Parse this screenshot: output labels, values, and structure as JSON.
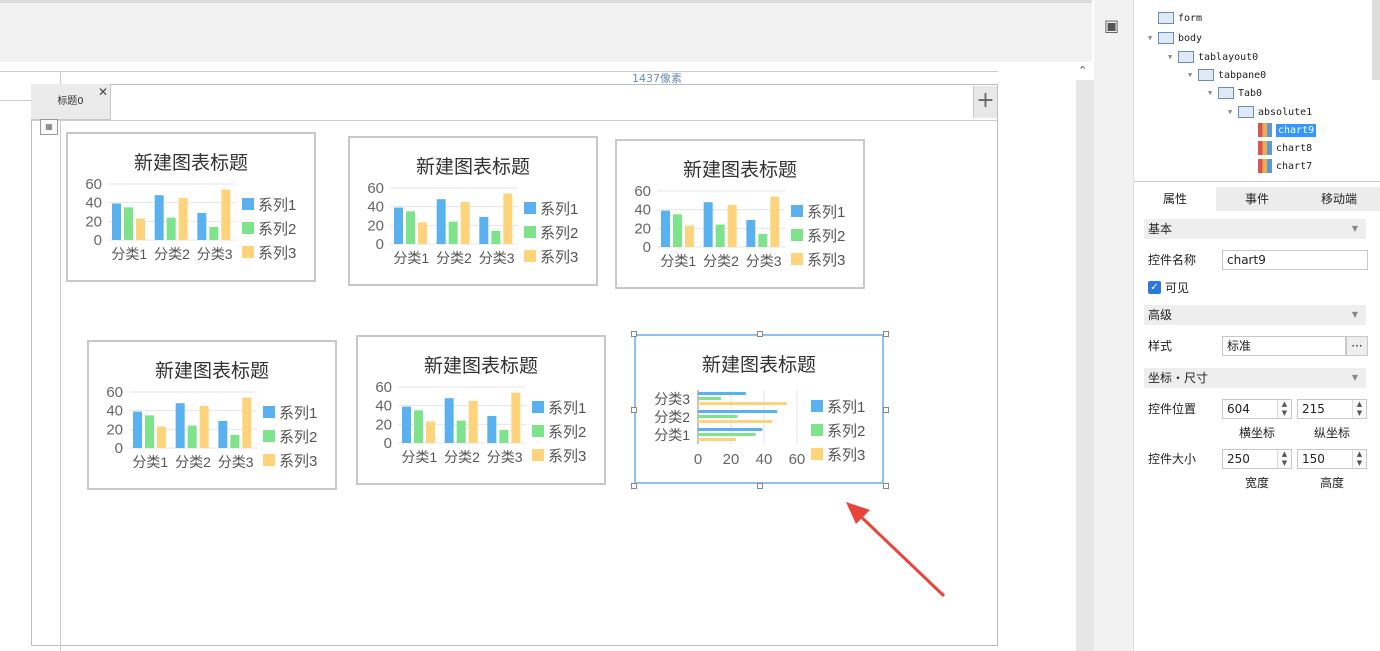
{
  "ruler": {
    "label": "1437像素"
  },
  "tab": {
    "label": "标题0",
    "close": "✕"
  },
  "tree": {
    "nodes": [
      {
        "label": "form",
        "level": 0,
        "expanded": false,
        "icon": "form-icon"
      },
      {
        "label": "body",
        "level": 0,
        "expanded": true,
        "icon": "body-icon"
      },
      {
        "label": "tablayout0",
        "level": 1,
        "expanded": true,
        "icon": "tablayout-icon"
      },
      {
        "label": "tabpane0",
        "level": 2,
        "expanded": true,
        "icon": "tabpane-icon"
      },
      {
        "label": "Tab0",
        "level": 3,
        "expanded": true,
        "icon": "tab-icon"
      },
      {
        "label": "absolute1",
        "level": 4,
        "expanded": true,
        "icon": "absolute-icon"
      },
      {
        "label": "chart9",
        "level": 5,
        "selected": true,
        "icon": "chart-icon"
      },
      {
        "label": "chart8",
        "level": 5,
        "icon": "chart-icon"
      },
      {
        "label": "chart7",
        "level": 5,
        "icon": "chart-icon"
      }
    ]
  },
  "panel_tabs": [
    {
      "label": "属性",
      "active": true
    },
    {
      "label": "事件"
    },
    {
      "label": "移动端"
    }
  ],
  "props": {
    "basic": "基本",
    "name_label": "控件名称",
    "name_value": "chart9",
    "visible_label": "可见",
    "advanced": "高级",
    "style_label": "样式",
    "style_value": "标准",
    "style_more": "···",
    "coord": "坐标・尺寸",
    "pos_label": "控件位置",
    "pos_x": "604",
    "pos_y": "215",
    "x_caption": "横坐标",
    "y_caption": "纵坐标",
    "size_label": "控件大小",
    "width": "250",
    "height": "150",
    "w_caption": "宽度",
    "h_caption": "高度"
  },
  "chart_data": [
    {
      "type": "bar",
      "title": "新建图表标题",
      "categories": [
        "分类1",
        "分类2",
        "分类3"
      ],
      "yticks": [
        "0",
        "20",
        "40",
        "60"
      ],
      "ylim": [
        0,
        60
      ],
      "legend": "right",
      "series": [
        {
          "name": "系列1",
          "values": [
            39,
            48,
            29
          ],
          "color": "#5ab1ef"
        },
        {
          "name": "系列2",
          "values": [
            35,
            24,
            14
          ],
          "color": "#7ee38b"
        },
        {
          "name": "系列3",
          "values": [
            23,
            45,
            54
          ],
          "color": "#fdd47c"
        }
      ]
    },
    {
      "type": "bar",
      "title": "新建图表标题",
      "categories": [
        "分类1",
        "分类2",
        "分类3"
      ],
      "yticks": [
        "0",
        "20",
        "40",
        "60"
      ],
      "ylim": [
        0,
        60
      ],
      "legend": "right",
      "series": [
        {
          "name": "系列1",
          "values": [
            39,
            48,
            29
          ],
          "color": "#5ab1ef"
        },
        {
          "name": "系列2",
          "values": [
            35,
            24,
            14
          ],
          "color": "#7ee38b"
        },
        {
          "name": "系列3",
          "values": [
            23,
            45,
            54
          ],
          "color": "#fdd47c"
        }
      ]
    },
    {
      "type": "bar",
      "title": "新建图表标题",
      "categories": [
        "分类1",
        "分类2",
        "分类3"
      ],
      "yticks": [
        "0",
        "20",
        "40",
        "60"
      ],
      "ylim": [
        0,
        60
      ],
      "legend": "right",
      "series": [
        {
          "name": "系列1",
          "values": [
            39,
            48,
            29
          ],
          "color": "#5ab1ef"
        },
        {
          "name": "系列2",
          "values": [
            35,
            24,
            14
          ],
          "color": "#7ee38b"
        },
        {
          "name": "系列3",
          "values": [
            23,
            45,
            54
          ],
          "color": "#fdd47c"
        }
      ]
    },
    {
      "type": "bar",
      "title": "新建图表标题",
      "categories": [
        "分类1",
        "分类2",
        "分类3"
      ],
      "yticks": [
        "0",
        "20",
        "40",
        "60"
      ],
      "ylim": [
        0,
        60
      ],
      "legend": "right",
      "series": [
        {
          "name": "系列1",
          "values": [
            39,
            48,
            29
          ],
          "color": "#5ab1ef"
        },
        {
          "name": "系列2",
          "values": [
            35,
            24,
            14
          ],
          "color": "#7ee38b"
        },
        {
          "name": "系列3",
          "values": [
            23,
            45,
            54
          ],
          "color": "#fdd47c"
        }
      ]
    },
    {
      "type": "bar",
      "title": "新建图表标题",
      "categories": [
        "分类1",
        "分类2",
        "分类3"
      ],
      "yticks": [
        "0",
        "20",
        "40",
        "60"
      ],
      "ylim": [
        0,
        60
      ],
      "legend": "right",
      "series": [
        {
          "name": "系列1",
          "values": [
            39,
            48,
            29
          ],
          "color": "#5ab1ef"
        },
        {
          "name": "系列2",
          "values": [
            35,
            24,
            14
          ],
          "color": "#7ee38b"
        },
        {
          "name": "系列3",
          "values": [
            23,
            45,
            54
          ],
          "color": "#fdd47c"
        }
      ]
    },
    {
      "type": "hbar",
      "title": "新建图表标题",
      "categories": [
        "分类1",
        "分类2",
        "分类3"
      ],
      "xticks": [
        "0",
        "20",
        "40",
        "60"
      ],
      "xlim": [
        0,
        60
      ],
      "legend": "right",
      "series": [
        {
          "name": "系列1",
          "values": [
            39,
            48,
            29
          ],
          "color": "#5ab1ef"
        },
        {
          "name": "系列2",
          "values": [
            35,
            24,
            14
          ],
          "color": "#7ee38b"
        },
        {
          "name": "系列3",
          "values": [
            23,
            45,
            54
          ],
          "color": "#fdd47c"
        }
      ]
    }
  ]
}
